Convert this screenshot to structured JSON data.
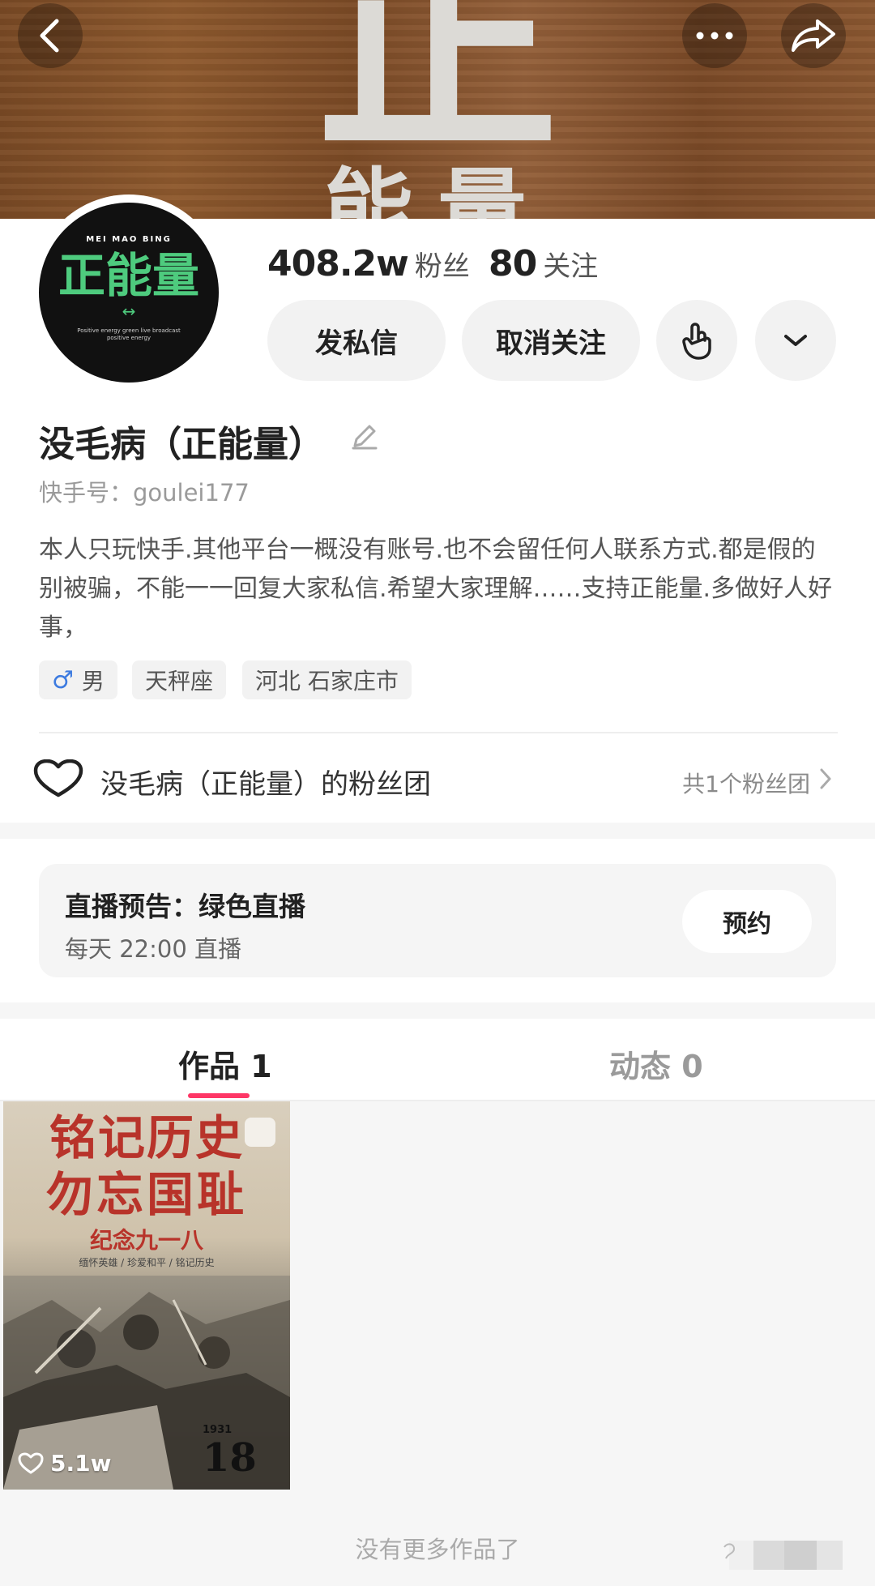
{
  "banner": {
    "text_big": "正",
    "text_small": "能量"
  },
  "header": {
    "back_icon": "chevron-left-icon",
    "more_icon": "more-dots-icon",
    "share_icon": "share-arrow-icon"
  },
  "avatar": {
    "top_text": "MEI  MAO  BING",
    "main_text": "正能量",
    "arrow_text": "↔",
    "sub1": "Positive energy green live broadcast",
    "sub2": "positive energy"
  },
  "stats": {
    "followers_num": "408.2w",
    "followers_label": "粉丝",
    "following_num": "80",
    "following_label": "关注"
  },
  "actions": {
    "message_label": "发私信",
    "unfollow_label": "取消关注"
  },
  "profile": {
    "name": "没毛病（正能量）",
    "account_id": "快手号：goulei177",
    "bio": "本人只玩快手.其他平台一概没有账号.也不会留任何人联系方式.都是假的别被骗，不能一一回复大家私信.希望大家理解……支持正能量.多做好人好事，",
    "tags": {
      "gender_symbol": "♂",
      "gender": "男",
      "zodiac": "天秤座",
      "location": "河北 石家庄市"
    }
  },
  "fan_group": {
    "title": "没毛病（正能量）的粉丝团",
    "count": "共1个粉丝团"
  },
  "live": {
    "title": "直播预告：绿色直播",
    "time": "每天 22:00 直播",
    "reserve_label": "预约"
  },
  "tabs": {
    "works": "作品 1",
    "moments": "动态 0"
  },
  "works": [
    {
      "title_line1": "铭记历史",
      "title_line2": "勿忘国耻",
      "subtitle": "纪念九一八",
      "caption": "缅怀英雄 / 珍爱和平 / 铭记历史",
      "year": "1931",
      "day": "18",
      "likes": "5.1w"
    }
  ],
  "footer": {
    "no_more": "没有更多作品了"
  },
  "colors": {
    "accent": "#fe3666",
    "avatar_green": "#4ecb7e"
  }
}
